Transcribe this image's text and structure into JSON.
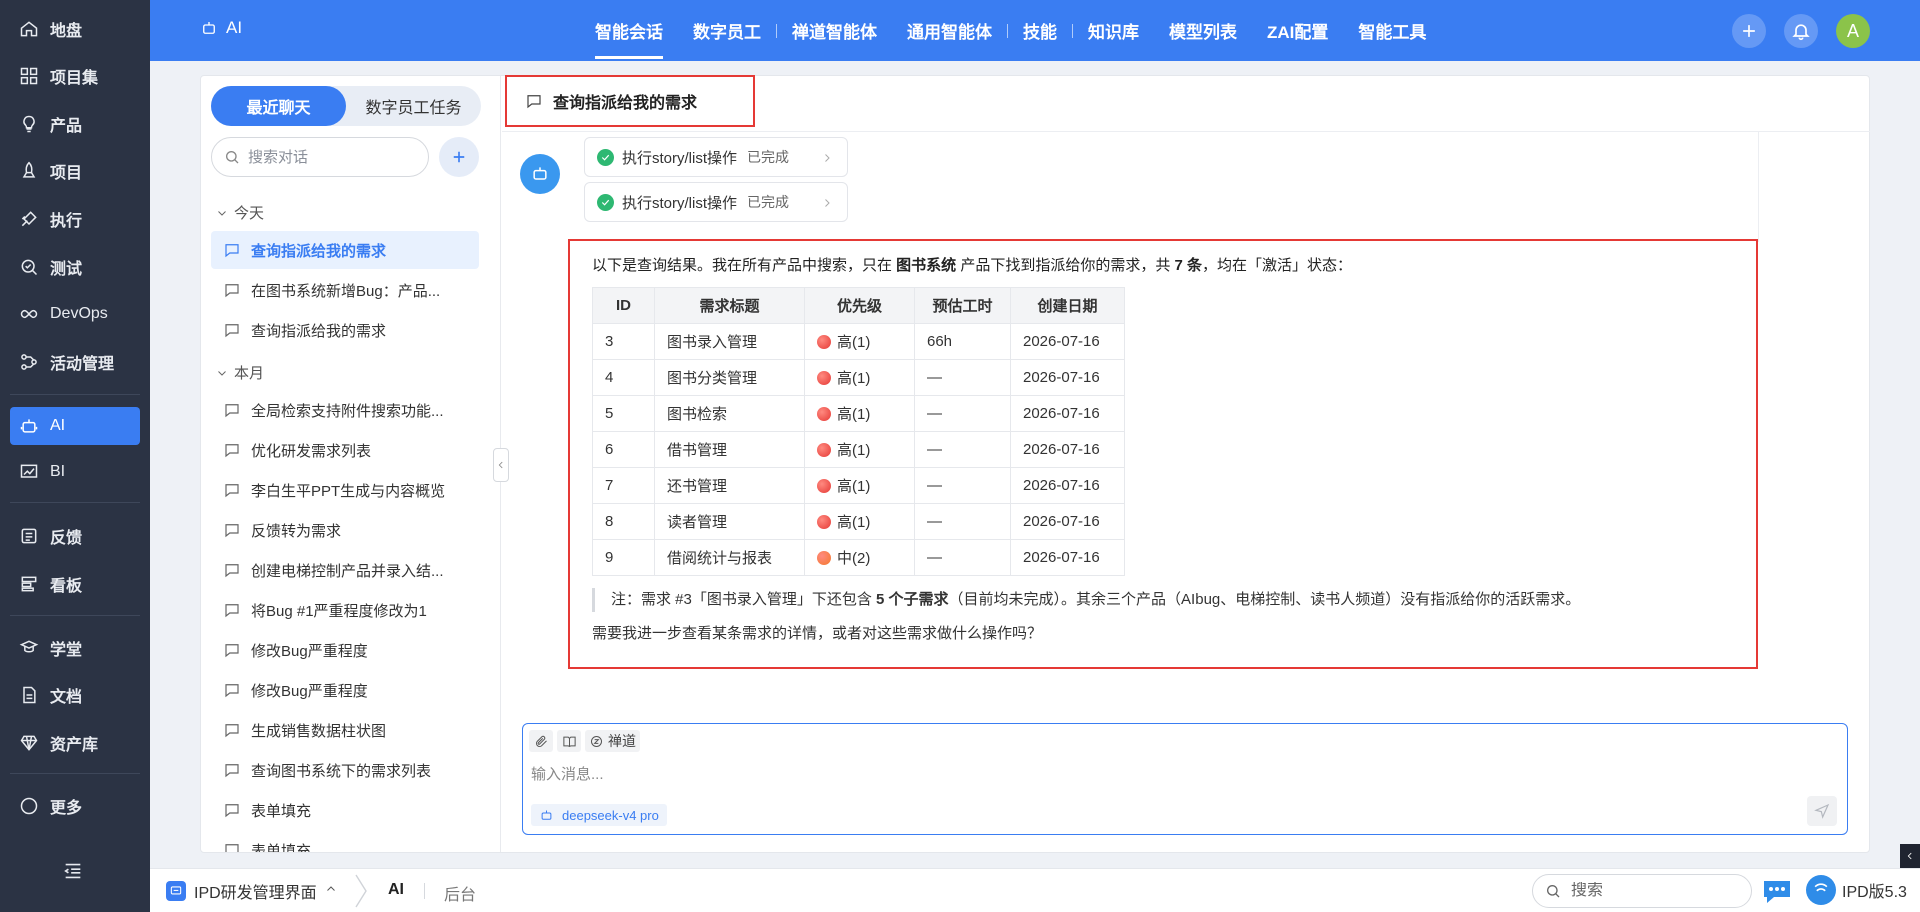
{
  "nav": {
    "items": [
      {
        "label": "地盘",
        "icon": "home-icon"
      },
      {
        "label": "项目集",
        "icon": "grid-icon"
      },
      {
        "label": "产品",
        "icon": "bulb-icon"
      },
      {
        "label": "项目",
        "icon": "rocket-icon"
      },
      {
        "label": "执行",
        "icon": "run-icon"
      },
      {
        "label": "测试",
        "icon": "search-check-icon"
      },
      {
        "label": "DevOps",
        "icon": "infinity-icon"
      },
      {
        "label": "活动管理",
        "icon": "flow-icon"
      },
      {
        "label": "AI",
        "icon": "robot-icon"
      },
      {
        "label": "BI",
        "icon": "chart-icon"
      },
      {
        "label": "反馈",
        "icon": "feedback-icon"
      },
      {
        "label": "看板",
        "icon": "board-icon"
      },
      {
        "label": "学堂",
        "icon": "school-icon"
      },
      {
        "label": "文档",
        "icon": "doc-icon"
      },
      {
        "label": "资产库",
        "icon": "diamond-icon"
      },
      {
        "label": "更多",
        "icon": "more-icon"
      }
    ],
    "active": "AI"
  },
  "topbar": {
    "brand": "AI",
    "menu": [
      "智能会话",
      "数字员工",
      "禅道智能体",
      "通用智能体",
      "技能",
      "知识库",
      "模型列表",
      "ZAI配置",
      "智能工具"
    ],
    "active": "智能会话",
    "avatar": "A"
  },
  "sidebar": {
    "tabs": [
      "最近聊天",
      "数字员工任务"
    ],
    "search_placeholder": "搜索对话",
    "groups": [
      {
        "title": "今天",
        "items": [
          "查询指派给我的需求",
          "在图书系统新增Bug：产品...",
          "查询指派给我的需求"
        ]
      },
      {
        "title": "本月",
        "items": [
          "全局检索支持附件搜索功能...",
          "优化研发需求列表",
          "李白生平PPT生成与内容概览",
          "反馈转为需求",
          "创建电梯控制产品并录入结...",
          "将Bug #1严重程度修改为1",
          "修改Bug严重程度",
          "修改Bug严重程度",
          "生成销售数据柱状图",
          "查询图书系统下的需求列表",
          "表单填充",
          "表单填充"
        ]
      }
    ]
  },
  "chat": {
    "title": "查询指派给我的需求",
    "tools": [
      {
        "name": "执行story/list操作",
        "status": "已完成"
      },
      {
        "name": "执行story/list操作",
        "status": "已完成"
      }
    ],
    "answer": {
      "intro_1": "以下是查询结果。我在所有产品中搜索，只在 ",
      "intro_product": "图书系统",
      "intro_2": " 产品下找到指派给你的需求，共 ",
      "intro_count": "7 条",
      "intro_3": "，均在「激活」状态：",
      "columns": [
        "ID",
        "需求标题",
        "优先级",
        "预估工时",
        "创建日期"
      ],
      "rows": [
        {
          "id": "3",
          "title": "图书录入管理",
          "pri": "高(1)",
          "color": "#e53935",
          "est": "66h",
          "date": "2026-07-16"
        },
        {
          "id": "4",
          "title": "图书分类管理",
          "pri": "高(1)",
          "color": "#e53935",
          "est": "—",
          "date": "2026-07-16"
        },
        {
          "id": "5",
          "title": "图书检索",
          "pri": "高(1)",
          "color": "#e53935",
          "est": "—",
          "date": "2026-07-16"
        },
        {
          "id": "6",
          "title": "借书管理",
          "pri": "高(1)",
          "color": "#e53935",
          "est": "—",
          "date": "2026-07-16"
        },
        {
          "id": "7",
          "title": "还书管理",
          "pri": "高(1)",
          "color": "#e53935",
          "est": "—",
          "date": "2026-07-16"
        },
        {
          "id": "8",
          "title": "读者管理",
          "pri": "高(1)",
          "color": "#e53935",
          "est": "—",
          "date": "2026-07-16"
        },
        {
          "id": "9",
          "title": "借阅统计与报表",
          "pri": "中(2)",
          "color": "#f4792b",
          "est": "—",
          "date": "2026-07-16"
        }
      ],
      "note_1": "注：需求 #3「图书录入管理」下还包含 ",
      "note_bold": "5 个子需求",
      "note_2": "（目前均未完成）。其余三个产品（AIbug、电梯控制、读书人频道）没有指派给你的活跃需求。",
      "follow": "需要我进一步查看某条需求的详情，或者对这些需求做什么操作吗？"
    },
    "composer": {
      "placeholder": "输入消息...",
      "tool_label": "禅道",
      "model": "deepseek-v4 pro"
    }
  },
  "bottombar": {
    "project": "IPD研发管理界面",
    "crumb_ai": "AI",
    "crumb_admin": "后台",
    "search_placeholder": "搜索",
    "version": "IPD版5.3"
  },
  "colors": {
    "brand": "#3a7df2",
    "nav_bg": "#2b3344",
    "highlight": "#e53935",
    "success": "#2eb872"
  }
}
